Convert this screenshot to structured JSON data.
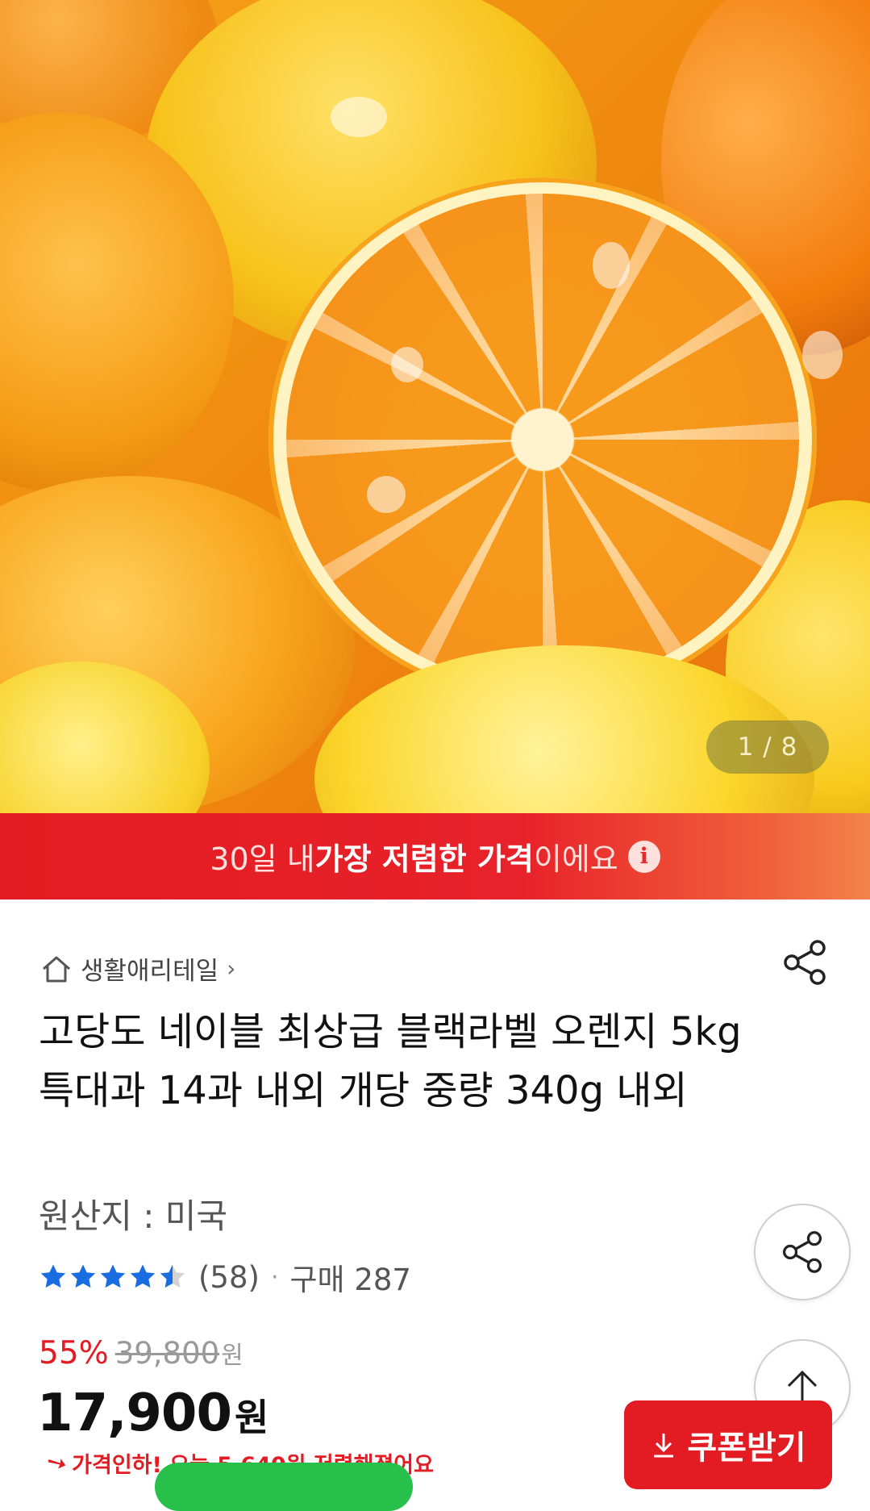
{
  "hero": {
    "counter": "1 / 8"
  },
  "banner": {
    "prefix": "30일 내 ",
    "highlight": "가장 저렴한 가격",
    "suffix": "이에요",
    "info_symbol": "i"
  },
  "breadcrumb": {
    "label": "생활애리테일",
    "chevron": "›"
  },
  "product": {
    "title": "고당도 네이블 최상급 블랙라벨 오렌지 5kg 특대과 14과 내외 개당 중량 340g 내외",
    "origin": "원산지 : 미국",
    "rating_value": 4.5,
    "review_count": "(58)",
    "dot": "·",
    "purchases": "구매 287"
  },
  "pricing": {
    "discount": "55%",
    "original_price": "39,800",
    "original_unit": "원",
    "price": "17,900",
    "price_unit": "원",
    "price_cut_text": "가격인하! 오늘 5,640원 저렴해졌어요"
  },
  "coupon": {
    "label": "쿠폰받기"
  },
  "colors": {
    "accent_red": "#e31b22",
    "star_blue": "#1a6de0"
  },
  "icons": {
    "home": "home-icon",
    "share": "share-icon",
    "scroll_top": "arrow-up-icon",
    "download": "download-icon",
    "info": "info-icon"
  }
}
